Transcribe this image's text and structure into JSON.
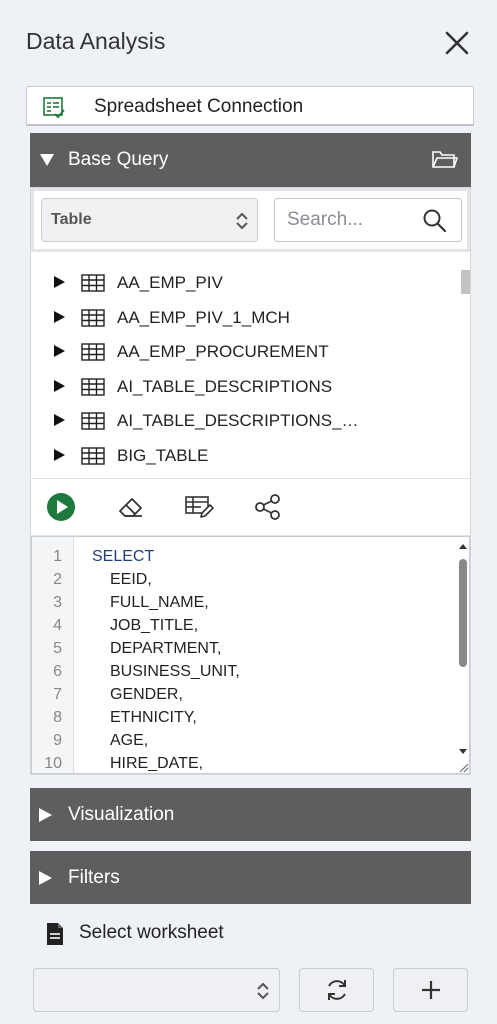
{
  "pane": {
    "title": "Data Analysis"
  },
  "connection": {
    "label": "Spreadsheet Connection"
  },
  "base_query": {
    "title": "Base Query",
    "type_select": {
      "value": "Table"
    },
    "search": {
      "placeholder": "Search..."
    },
    "tables": [
      "AA_EMP_PIV",
      "AA_EMP_PIV_1_MCH",
      "AA_EMP_PROCUREMENT",
      "AI_TABLE_DESCRIPTIONS",
      "AI_TABLE_DESCRIPTIONS_…",
      "BIG_TABLE"
    ]
  },
  "editor": {
    "line_numbers": [
      "1",
      "2",
      "3",
      "4",
      "5",
      "6",
      "7",
      "8",
      "9",
      "10"
    ],
    "lines": [
      "SELECT",
      "EEID,",
      "FULL_NAME,",
      "JOB_TITLE,",
      "DEPARTMENT,",
      "BUSINESS_UNIT,",
      "GENDER,",
      "ETHNICITY,",
      "AGE,",
      "HIRE_DATE,"
    ]
  },
  "sections": {
    "visualization": "Visualization",
    "filters": "Filters"
  },
  "worksheet": {
    "label": "Select worksheet",
    "selected": ""
  },
  "colors": {
    "header_bg": "#5e5e5e",
    "run_green": "#1e7a3c",
    "keyword_blue": "#1f3f7f",
    "pane_bg": "#eef1f5"
  },
  "icons": [
    "close-icon",
    "spreadsheet-check-icon",
    "folder-open-icon",
    "caret-down-icon",
    "search-icon",
    "table-grid-icon",
    "run-icon",
    "eraser-icon",
    "edit-table-icon",
    "share-icon",
    "document-icon",
    "refresh-icon",
    "plus-icon",
    "caret-right-icon"
  ]
}
